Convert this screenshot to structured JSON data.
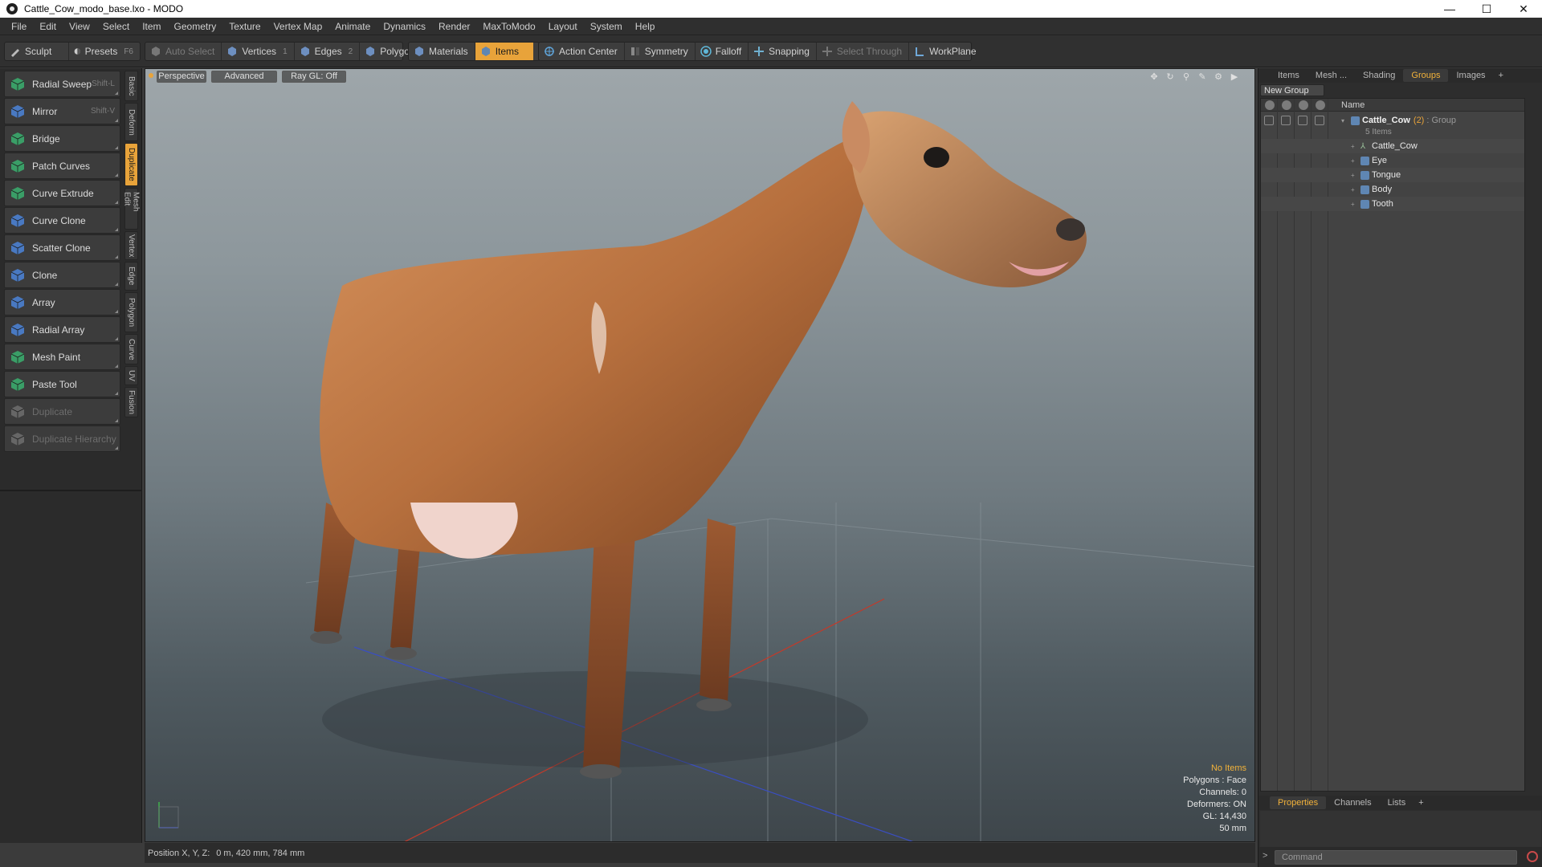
{
  "window": {
    "title": "Cattle_Cow_modo_base.lxo - MODO",
    "controls": {
      "minimize": "—",
      "maximize": "☐",
      "close": "✕"
    }
  },
  "menu": [
    "File",
    "Edit",
    "View",
    "Select",
    "Item",
    "Geometry",
    "Texture",
    "Vertex Map",
    "Animate",
    "Dynamics",
    "Render",
    "MaxToModo",
    "Layout",
    "System",
    "Help"
  ],
  "toolbar": {
    "sculpt": "Sculpt",
    "presets": "Presets",
    "presets_key": "F6",
    "auto_select": "Auto Select",
    "vertices": "Vertices",
    "vertices_num": "1",
    "edges": "Edges",
    "edges_num": "2",
    "polygons": "Polygons",
    "materials": "Materials",
    "items": "Items",
    "action_center": "Action Center",
    "symmetry": "Symmetry",
    "falloff": "Falloff",
    "snapping": "Snapping",
    "select_through": "Select Through",
    "workplane": "WorkPlane"
  },
  "tools": [
    {
      "label": "Radial Sweep",
      "shortcut": "Shift-L",
      "icon": "radial-sweep-icon",
      "color": "#3aa86b",
      "enabled": true
    },
    {
      "label": "Mirror",
      "shortcut": "Shift-V",
      "icon": "mirror-icon",
      "color": "#4a7fd0",
      "enabled": true
    },
    {
      "label": "Bridge",
      "shortcut": "",
      "icon": "bridge-icon",
      "color": "#3aa86b",
      "enabled": true
    },
    {
      "label": "Patch Curves",
      "shortcut": "",
      "icon": "patch-curves-icon",
      "color": "#3aa86b",
      "enabled": true
    },
    {
      "label": "Curve Extrude",
      "shortcut": "",
      "icon": "curve-extrude-icon",
      "color": "#3aa86b",
      "enabled": true
    },
    {
      "label": "Curve Clone",
      "shortcut": "",
      "icon": "curve-clone-icon",
      "color": "#4a7fd0",
      "enabled": true
    },
    {
      "label": "Scatter Clone",
      "shortcut": "",
      "icon": "scatter-clone-icon",
      "color": "#4a7fd0",
      "enabled": true
    },
    {
      "label": "Clone",
      "shortcut": "",
      "icon": "clone-icon",
      "color": "#4a7fd0",
      "enabled": true
    },
    {
      "label": "Array",
      "shortcut": "",
      "icon": "array-icon",
      "color": "#4a7fd0",
      "enabled": true
    },
    {
      "label": "Radial Array",
      "shortcut": "",
      "icon": "radial-array-icon",
      "color": "#4a7fd0",
      "enabled": true
    },
    {
      "label": "Mesh Paint",
      "shortcut": "",
      "icon": "mesh-paint-icon",
      "color": "#3aa86b",
      "enabled": true
    },
    {
      "label": "Paste Tool",
      "shortcut": "",
      "icon": "paste-tool-icon",
      "color": "#3aa86b",
      "enabled": true
    },
    {
      "label": "Duplicate",
      "shortcut": "",
      "icon": "duplicate-icon",
      "color": "#6a6a6a",
      "enabled": false
    },
    {
      "label": "Duplicate Hierarchy",
      "shortcut": "",
      "icon": "duplicate-hierarchy-icon",
      "color": "#6a6a6a",
      "enabled": false
    }
  ],
  "vertical_tabs": [
    {
      "label": "Basic",
      "active": false
    },
    {
      "label": "Deform",
      "active": false
    },
    {
      "label": "Duplicate",
      "active": true
    },
    {
      "label": "Mesh Edit",
      "active": false
    },
    {
      "label": "Vertex",
      "active": false
    },
    {
      "label": "Edge",
      "active": false
    },
    {
      "label": "Polygon",
      "active": false
    },
    {
      "label": "Curve",
      "active": false
    },
    {
      "label": "UV",
      "active": false
    },
    {
      "label": "Fusion",
      "active": false
    }
  ],
  "viewport": {
    "view": "Perspective",
    "mode": "Advanced",
    "raygl": "Ray GL: Off",
    "info": {
      "selection": "No Items",
      "polygons": "Polygons : Face",
      "channels": "Channels: 0",
      "deformers": "Deformers: ON",
      "gl": "GL: 14,430",
      "units": "50 mm"
    }
  },
  "status": {
    "label": "Position X, Y, Z:",
    "value": "0 m, 420 mm, 784 mm"
  },
  "right_panel": {
    "tabs": [
      "Items",
      "Mesh ...",
      "Shading",
      "Groups",
      "Images"
    ],
    "active_tab": "Groups",
    "new_group": "New Group",
    "column_name": "Name",
    "group": {
      "name": "Cattle_Cow",
      "count": "(2)",
      "type": ": Group",
      "items_note": "5 Items",
      "children": [
        "Cattle_Cow",
        "Eye",
        "Tongue",
        "Body",
        "Tooth"
      ]
    },
    "bottom_tabs": [
      "Properties",
      "Channels",
      "Lists"
    ],
    "bottom_active": "Properties",
    "command_placeholder": "Command"
  },
  "colors": {
    "accent": "#e8a33a",
    "item_blue": "#5f86b3"
  }
}
